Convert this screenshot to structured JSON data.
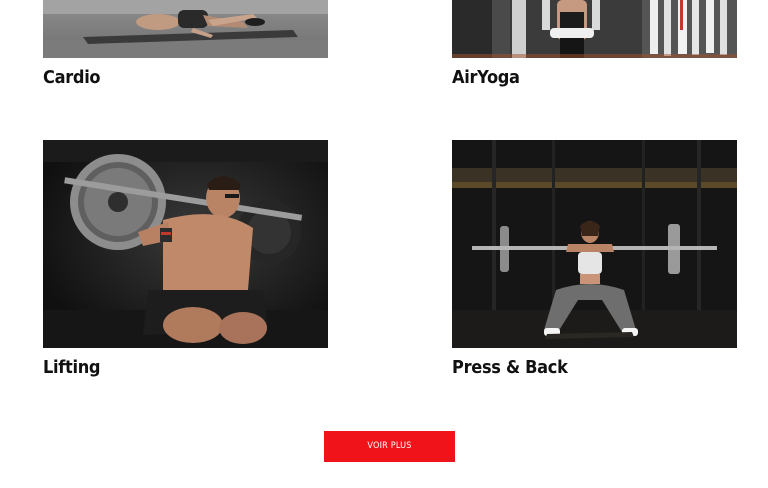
{
  "cards": [
    {
      "title": "Cardio",
      "image": "woman-stretching-on-mat-photo"
    },
    {
      "title": "AirYoga",
      "image": "aerial-yoga-silks-photo"
    },
    {
      "title": "Lifting",
      "image": "man-barbell-squat-photo"
    },
    {
      "title": "Press & Back",
      "image": "woman-front-squat-barbell-photo"
    }
  ],
  "more_button": {
    "label": "VOIR PLUS"
  },
  "colors": {
    "accent": "#f0141a",
    "title_text": "#111111",
    "background": "#ffffff"
  }
}
